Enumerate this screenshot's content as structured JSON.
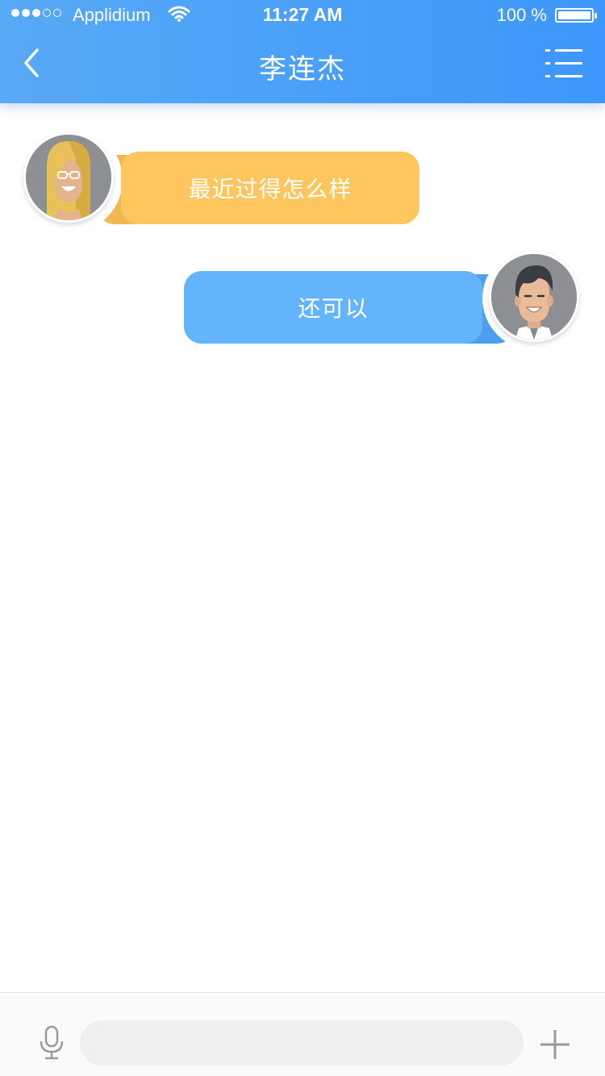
{
  "status_bar": {
    "carrier": "Applidium",
    "time": "11:27 AM",
    "battery": "100 %",
    "signal_dots_filled": 3,
    "signal_dots_total": 5
  },
  "nav": {
    "title": "李连杰",
    "back_icon": "chevron-left-icon",
    "menu_icon": "list-menu-icon"
  },
  "messages": [
    {
      "side": "left",
      "sender": "contact",
      "text": "最近过得怎么样",
      "color": "#ffc55e"
    },
    {
      "side": "right",
      "sender": "me",
      "text": "还可以",
      "color": "#63b4fb"
    }
  ],
  "input_bar": {
    "placeholder": "",
    "mic_icon": "microphone-icon",
    "add_icon": "plus-icon"
  },
  "colors": {
    "header_start": "#58a9f6",
    "header_end": "#3d97fa",
    "incoming_bubble": "#ffc55e",
    "outgoing_bubble": "#63b4fb"
  }
}
